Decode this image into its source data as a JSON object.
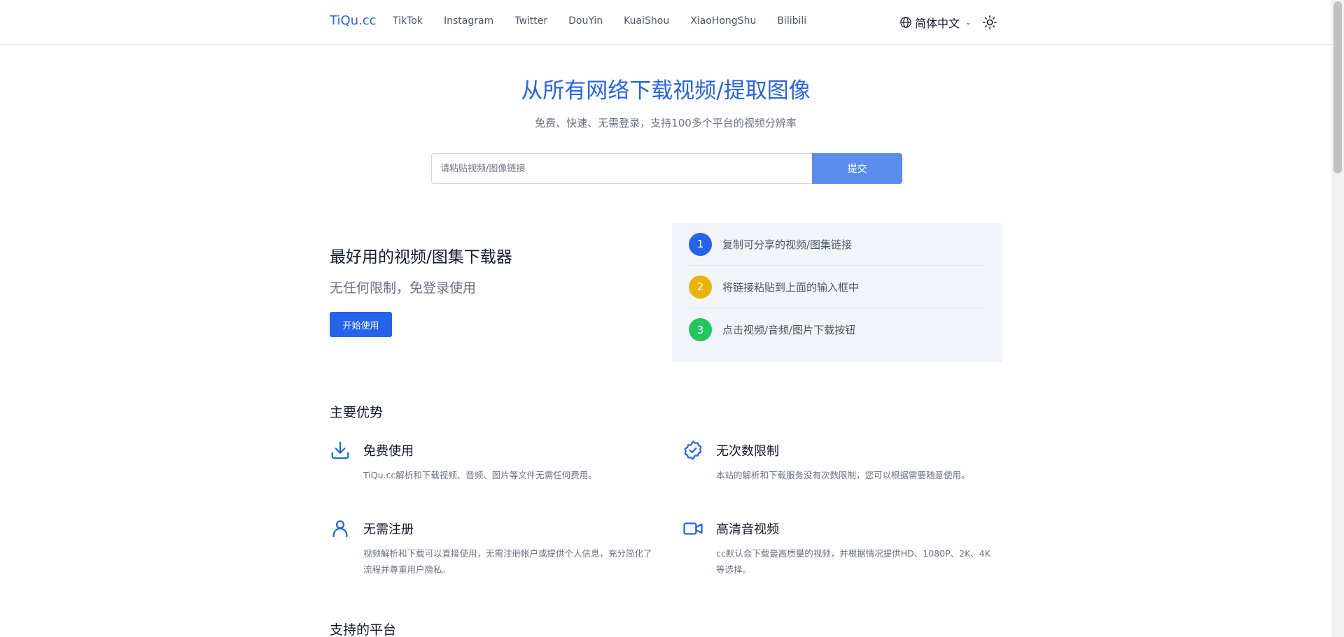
{
  "header": {
    "brand": "TiQu.cc",
    "nav": [
      "TikTok",
      "Instagram",
      "Twitter",
      "DouYin",
      "KuaiShou",
      "XiaoHongShu",
      "Bilibili"
    ],
    "language": "简体中文",
    "icons": {
      "language": "globe-icon",
      "theme": "sun-icon"
    }
  },
  "hero": {
    "title": "从所有网络下载视频/提取图像",
    "subtitle": "免费、快速、无需登录，支持100多个平台的视频分辨率",
    "search_placeholder": "请粘贴视频/图像链接",
    "search_value": "",
    "submit_label": "提交"
  },
  "promo": {
    "title": "最好用的视频/图集下载器",
    "subtitle": "无任何限制，免登录使用",
    "button_label": "开始使用"
  },
  "steps": [
    {
      "num": "1",
      "text": "复制可分享的视频/图集链接",
      "color": "#2563eb"
    },
    {
      "num": "2",
      "text": "将链接粘贴到上面的输入框中",
      "color": "#eab308"
    },
    {
      "num": "3",
      "text": "点击视频/音频/图片下载按钮",
      "color": "#22c55e"
    }
  ],
  "advantages": {
    "title": "主要优势",
    "items": [
      {
        "icon": "download-icon",
        "title": "免费使用",
        "desc": "TiQu.cc解析和下载视频、音频、图片等文件无需任何费用。"
      },
      {
        "icon": "badge-check-icon",
        "title": "无次数限制",
        "desc": "本站的解析和下载服务没有次数限制，您可以根据需要随意使用。"
      },
      {
        "icon": "user-icon",
        "title": "无需注册",
        "desc": "视频解析和下载可以直接使用，无需注册帐户或提供个人信息，充分简化了流程并尊重用户隐私。"
      },
      {
        "icon": "video-camera-icon",
        "title": "高清音视频",
        "desc": "cc默认会下载最高质量的视频，并根据情况提供HD、1080P、2K、4K等选择。"
      }
    ]
  },
  "platforms": {
    "title": "支持的平台"
  },
  "colors": {
    "accent": "#2563eb",
    "submit": "#5b8def",
    "steps_bg": "#f1f4f8"
  }
}
